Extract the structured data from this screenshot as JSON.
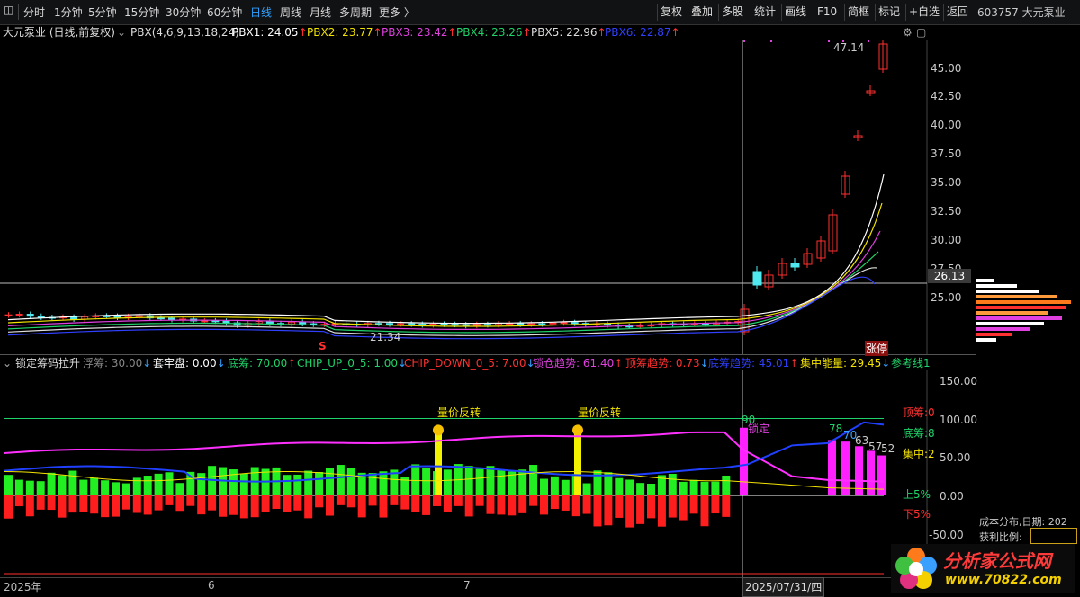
{
  "toolbar": {
    "left_items": [
      "分时",
      "1分钟",
      "5分钟",
      "15分钟",
      "30分钟",
      "60分钟",
      "日线",
      "周线",
      "月线",
      "多周期",
      "更多 〉"
    ],
    "active": "日线",
    "right_items": [
      "复权",
      "叠加",
      "多股",
      "统计",
      "画线",
      "F10",
      "简框",
      "标记",
      "+自选",
      "返回"
    ],
    "stock": "603757 大元泵业"
  },
  "main_legend": {
    "title": "大元泵业 (日线,前复权)",
    "formula": "PBX(4,6,9,13,18,24)",
    "items": [
      {
        "label": "PBX1: 24.05",
        "arrow": "↑",
        "color": "#ffffff"
      },
      {
        "label": "PBX2: 23.77",
        "arrow": "↑",
        "color": "#f2e200"
      },
      {
        "label": "PBX3: 23.42",
        "arrow": "↑",
        "color": "#e040e0"
      },
      {
        "label": "PBX4: 23.26",
        "arrow": "↑",
        "color": "#1fd36a"
      },
      {
        "label": "PBX5: 22.96",
        "arrow": "↑",
        "color": "#dddddd"
      },
      {
        "label": "PBX6: 22.87",
        "arrow": "↑",
        "color": "#3040ff"
      }
    ]
  },
  "price_axis": {
    "ticks": [
      "45.00",
      "42.50",
      "40.00",
      "37.50",
      "35.00",
      "32.50",
      "30.00",
      "27.50",
      "25.00"
    ],
    "current": "26.13"
  },
  "annotations": {
    "high": "47.14",
    "low": "21.34",
    "limit_up": "涨停",
    "signal": "S"
  },
  "indicator_legend": {
    "title": "锁定筹码拉升",
    "items": [
      {
        "label": "浮筹: 30.00",
        "arrow": "↓",
        "color": "#888888"
      },
      {
        "label": "套牢盘: 0.00",
        "arrow": "↓",
        "color": "#ffffff"
      },
      {
        "label": "底筹: 70.00",
        "arrow": "↑",
        "color": "#1fd36a"
      },
      {
        "label": "CHIP_UP_0_5: 1.00",
        "arrow": "↓",
        "color": "#1fd36a"
      },
      {
        "label": "CHIP_DOWN_0_5: 7.00",
        "arrow": "↓",
        "color": "#ff3030"
      },
      {
        "label": "锁仓趋势: 61.40",
        "arrow": "↑",
        "color": "#e040e0"
      },
      {
        "label": "顶筹趋势: 0.73",
        "arrow": "↓",
        "color": "#ff3030"
      },
      {
        "label": "底筹趋势: 45.01",
        "arrow": "↑",
        "color": "#3040ff"
      },
      {
        "label": "集中能量: 29.45",
        "arrow": "↓",
        "color": "#f2e200"
      },
      {
        "label": "参考线1",
        "arrow": "",
        "color": "#1fd36a"
      }
    ]
  },
  "indicator_axis": {
    "ticks": [
      "150.00",
      "100.00",
      "50.00",
      "0.00",
      "-50.00"
    ]
  },
  "indicator_labels": {
    "reversal_1": "量价反转",
    "reversal_2": "量价反转",
    "lock": "锁定",
    "v90": "90",
    "v78": "78",
    "v70": "70",
    "v63": "63",
    "v57": "57",
    "v52": "52",
    "top_chip": "顶筹:0",
    "bottom_chip": "底筹:8",
    "concentration": "集中:2",
    "up5": "上5%",
    "down5": "下5%"
  },
  "date_axis": {
    "labels": [
      "2025年",
      "6",
      "7"
    ],
    "cursor": "2025/07/31/四"
  },
  "chip_panel": {
    "date_label": "成本分布,日期: 202",
    "profit_label": "获利比例:"
  },
  "watermark": {
    "text": "分析家公式网",
    "url": "www.70822.com"
  }
}
